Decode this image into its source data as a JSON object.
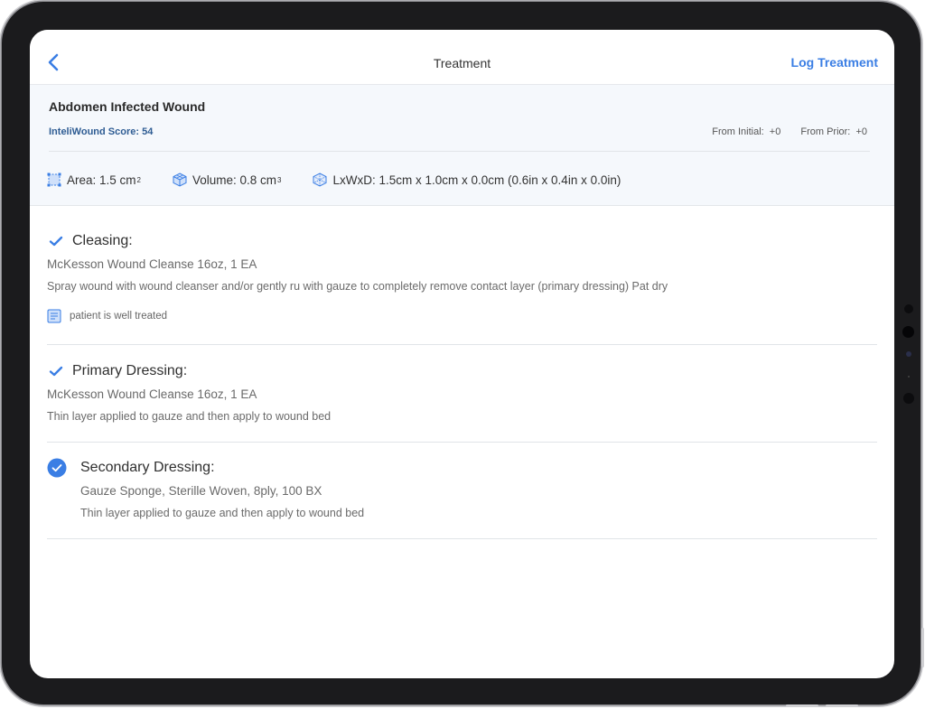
{
  "nav": {
    "title": "Treatment",
    "action_label": "Log Treatment"
  },
  "summary": {
    "wound_name": "Abdomen Infected Wound",
    "score_label": "InteliWound Score: 54",
    "from_initial": "From Initial:  +0",
    "from_prior": "From Prior:  +0",
    "area_label": "Area: 1.5 cm",
    "area_unit_exp": "2",
    "volume_label": "Volume: 0.8 cm",
    "volume_unit_exp": "3",
    "dims_label": "LxWxD: 1.5cm x 1.0cm x 0.0cm (0.6in x 0.4in x 0.0in)"
  },
  "treatments": [
    {
      "title": "Cleasing:",
      "product": "McKesson Wound Cleanse 16oz, 1 EA",
      "description": "Spray wound with wound cleanser and/or gently ru with gauze to completely remove contact layer (primary dressing) Pat dry",
      "note": "patient is well treated",
      "status_icon": "checkmark-icon"
    },
    {
      "title": "Primary Dressing:",
      "product": "McKesson Wound Cleanse 16oz, 1 EA",
      "description": "Thin layer applied to gauze and then apply to wound bed",
      "status_icon": "checkmark-icon"
    },
    {
      "title": "Secondary Dressing:",
      "product": "Gauze Sponge, Sterille Woven, 8ply, 100 BX",
      "description": "Thin layer applied to gauze and then apply to wound bed",
      "status_icon": "check-circle-icon"
    }
  ],
  "colors": {
    "accent": "#3a7ee4",
    "score": "#2e5c93",
    "summary_bg": "#f5f8fc"
  }
}
